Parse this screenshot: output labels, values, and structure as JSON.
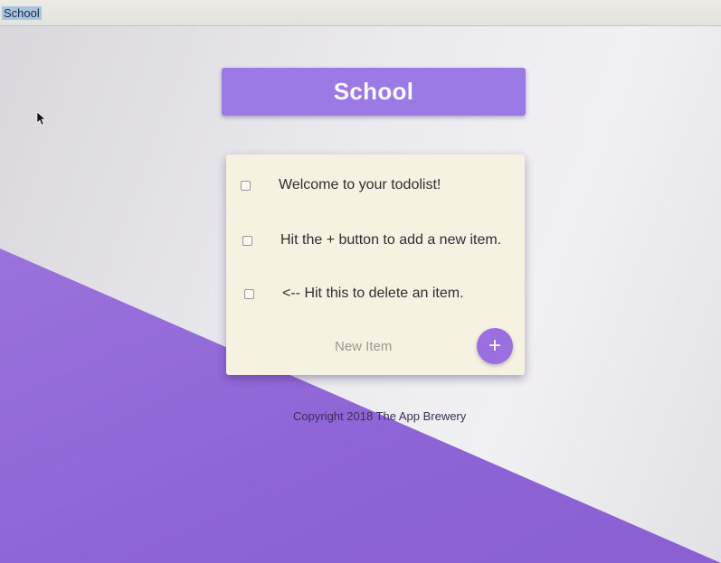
{
  "window": {
    "title": "School"
  },
  "list": {
    "title": "School",
    "items": [
      {
        "label": "Welcome to your todolist!",
        "checked": false
      },
      {
        "label": "Hit the + button to add a new item.",
        "checked": false
      },
      {
        "label": "<-- Hit this to delete an item.",
        "checked": false
      }
    ],
    "new_item_placeholder": "New Item",
    "add_button_label": "+"
  },
  "footer": {
    "copyright": "Copyright 2018 The App Brewery"
  },
  "colors": {
    "accent": "#9b7ae6",
    "card_background": "#f6f2e2",
    "diagonal_band": "#9168d8"
  },
  "icons": {
    "add": "plus-icon",
    "cursor": "mouse-pointer-icon"
  }
}
